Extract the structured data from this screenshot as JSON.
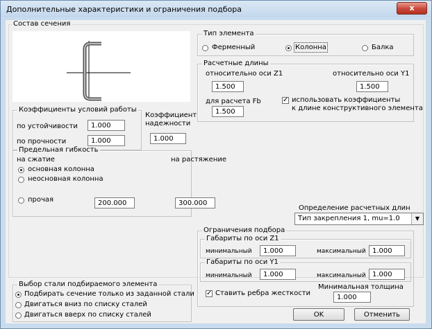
{
  "window": {
    "title": "Дополнительные характеристики и ограничения подбора",
    "close_label": "x"
  },
  "section": {
    "label": "Состав сечения"
  },
  "element_type": {
    "label": "Тип элемента",
    "options": [
      {
        "label": "Ферменный",
        "selected": false
      },
      {
        "label": "Колонна",
        "selected": true
      },
      {
        "label": "Балка",
        "selected": false
      }
    ]
  },
  "calc_lengths": {
    "label": "Расчетные длины",
    "z1_label": "относительно оси Z1",
    "z1_value": "1.500",
    "y1_label": "относительно оси Y1",
    "y1_value": "1.500",
    "fb_label": "для расчета Fb",
    "fb_value": "1.500",
    "use_coef_checked": true,
    "use_coef_line1": "использовать коэффициенты",
    "use_coef_line2": "к длине конструктивного элемента"
  },
  "work_coef": {
    "label": "Коэффициенты условий работы",
    "stability_label": "по устойчивости",
    "stability_value": "1.000",
    "strength_label": "по прочности",
    "strength_value": "1.000"
  },
  "reliability": {
    "line1": "Коэффициент",
    "line2": "надежности",
    "value": "1.000"
  },
  "slenderness": {
    "label": "Предельная гибкость",
    "compression_label": "на сжатие",
    "tension_label": "на растяжение",
    "options": [
      {
        "label": "основная колонна",
        "selected": true
      },
      {
        "label": "неосновная колонна",
        "selected": false
      },
      {
        "label": "прочая",
        "selected": false
      }
    ],
    "compression_value": "200.000",
    "tension_value": "300.000"
  },
  "length_def": {
    "label": "Определение расчетных длин",
    "selected": "Тип закрепления 1, mu=1.0"
  },
  "limits": {
    "label": "Ограничения подбора",
    "z1_label": "Габариты по оси Z1",
    "z1_min_label": "минимальный",
    "z1_min": "1.000",
    "z1_max_label": "максимальный",
    "z1_max": "1.000",
    "y1_label": "Габариты по оси Y1",
    "y1_min_label": "минимальный",
    "y1_min": "1.000",
    "y1_max_label": "максимальный",
    "y1_max": "1.000",
    "stiffeners_checked": true,
    "stiffeners_label": "Ставить ребра жесткости",
    "min_thickness_label": "Минимальная толщина",
    "min_thickness": "1.000"
  },
  "steel_choice": {
    "label": "Выбор стали подбираемого элемента",
    "options": [
      {
        "label": "Подбирать сечение только из заданной стали",
        "selected": true
      },
      {
        "label": "Двигаться вниз по списку сталей",
        "selected": false
      },
      {
        "label": "Двигаться вверх по списку сталей",
        "selected": false
      }
    ]
  },
  "buttons": {
    "ok": "OK",
    "cancel": "Отменить"
  },
  "icons": {
    "close": "close-icon",
    "section_preview": "channel-section-icon",
    "dropdown": "chevron-down-icon"
  },
  "colors": {
    "title_bg": "#c9dcef",
    "close_bg": "#c7473a",
    "dialog_bg": "#f0f0f0"
  }
}
